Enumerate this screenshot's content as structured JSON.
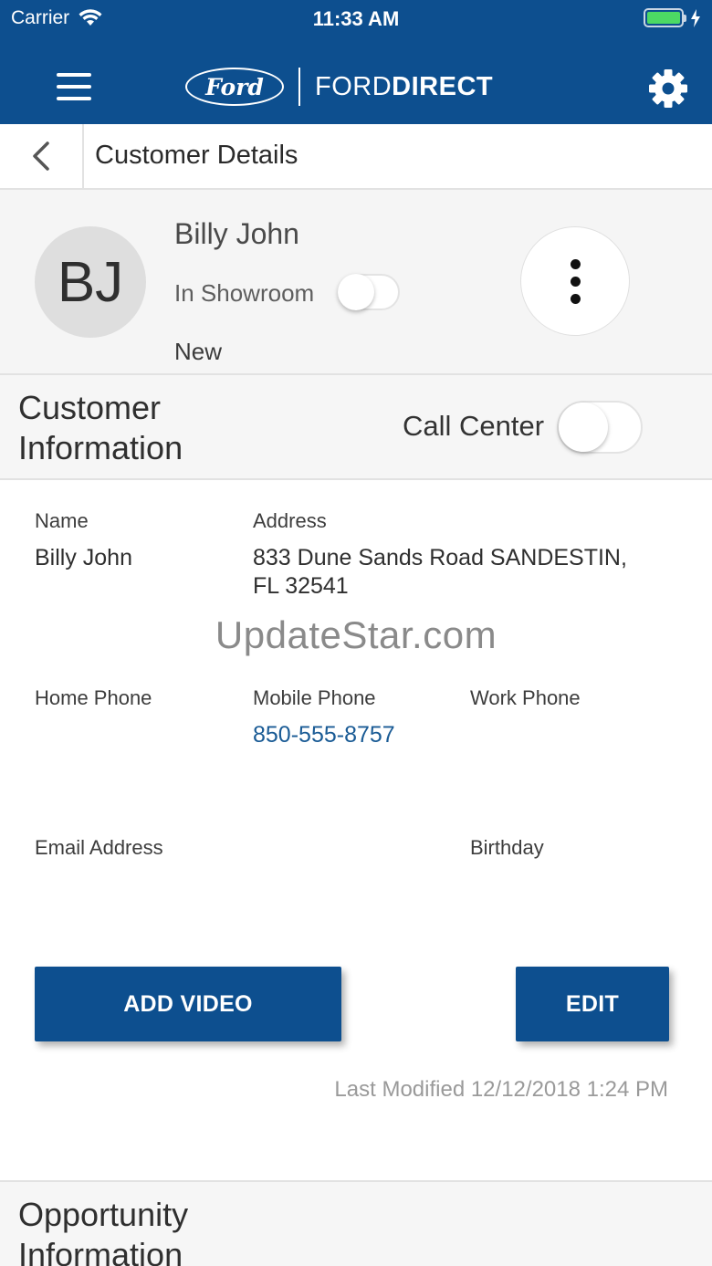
{
  "status_bar": {
    "carrier": "Carrier",
    "time": "11:33 AM",
    "battery_color": "#4cd964"
  },
  "header": {
    "ford_logo_text": "Ford",
    "brand_regular": "FORD",
    "brand_bold": "DIRECT",
    "menu_icon": "hamburger-icon",
    "settings_icon": "gear-icon",
    "bg_color": "#0d4f8f"
  },
  "subheader": {
    "title": "Customer Details",
    "back_icon": "chevron-left-icon"
  },
  "profile": {
    "initials": "BJ",
    "name": "Billy John",
    "showroom_label": "In Showroom",
    "showroom_on": false,
    "status": "New",
    "more_icon": "more-vertical-icon"
  },
  "customer_info": {
    "title": "Customer Information",
    "call_center_label": "Call Center",
    "call_center_on": false,
    "fields": {
      "name_label": "Name",
      "name_value": "Billy John",
      "address_label": "Address",
      "address_line1": "833 Dune Sands Road SANDESTIN,",
      "address_line2": "FL 32541",
      "home_phone_label": "Home Phone",
      "home_phone_value": "",
      "mobile_phone_label": "Mobile Phone",
      "mobile_phone_value": "850-555-8757",
      "work_phone_label": "Work Phone",
      "work_phone_value": "",
      "email_label": "Email Address",
      "email_value": "",
      "birthday_label": "Birthday",
      "birthday_value": ""
    },
    "watermark": "UpdateStar.com",
    "add_video_label": "ADD VIDEO",
    "edit_label": "EDIT",
    "last_modified": "Last Modified 12/12/2018 1:24 PM"
  },
  "opportunity_info": {
    "title": "Opportunity Information"
  }
}
